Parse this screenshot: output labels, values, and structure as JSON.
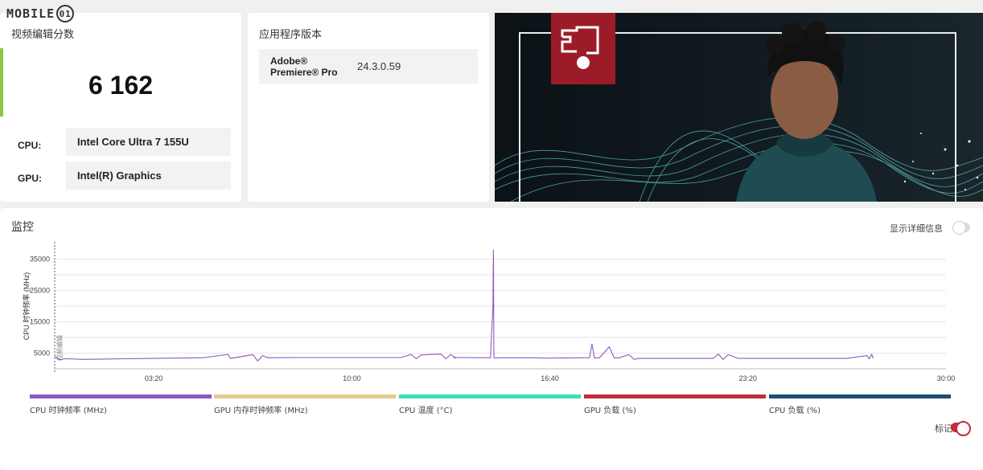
{
  "logo": {
    "text": "MOBILE",
    "badge": "01"
  },
  "score_card": {
    "title": "视频编辑分数",
    "score": "6 162",
    "cpu_label": "CPU:",
    "cpu_value": "Intel Core Ultra 7 155U",
    "gpu_label": "GPU:",
    "gpu_value": "Intel(R) Graphics",
    "accent_color": "#8dc63f"
  },
  "version_card": {
    "title": "应用程序版本",
    "app_name": "Adobe® Premiere® Pro",
    "app_version": "24.3.0.59"
  },
  "hero": {
    "icon": "video-editing-icon",
    "accent_color": "#9b1c28"
  },
  "monitor": {
    "title": "监控",
    "detail_toggle_label": "显示详细信息",
    "detail_toggle_on": false,
    "marker_toggle_label": "标记",
    "marker_toggle_on": true
  },
  "legend": [
    {
      "label": "CPU 时钟频率 (MHz)",
      "color": "#8e57c2"
    },
    {
      "label": "GPU 内存时钟频率 (MHz)",
      "color": "#e6c98b"
    },
    {
      "label": "CPU 温度 (°C)",
      "color": "#3fdbbd"
    },
    {
      "label": "GPU 负载 (%)",
      "color": "#c22d3a"
    },
    {
      "label": "CPU 负载 (%)",
      "color": "#1f4e79"
    }
  ],
  "chart_data": {
    "type": "line",
    "ylabel": "CPU 时钟频率 (MHz)",
    "marker_label": "视频编辑",
    "ylim": [
      0,
      40000
    ],
    "yticks": [
      5000,
      15000,
      25000,
      35000
    ],
    "ytick_labels": [
      "5000",
      "15000",
      "25000",
      "35000"
    ],
    "xlim": [
      0,
      1800
    ],
    "xticks": [
      200,
      600,
      1000,
      1400,
      1800
    ],
    "xtick_labels": [
      "03:20",
      "10:00",
      "16:40",
      "23:20",
      "30:00"
    ],
    "grid": true,
    "series": [
      {
        "name": "CPU 时钟频率 (MHz)",
        "color": "#8e57c2",
        "x": [
          0,
          10,
          20,
          60,
          150,
          200,
          300,
          350,
          355,
          400,
          410,
          420,
          430,
          500,
          700,
          720,
          730,
          740,
          780,
          790,
          800,
          810,
          805,
          880,
          885,
          886,
          887,
          889,
          900,
          970,
          980,
          1000,
          1080,
          1085,
          1090,
          1100,
          1120,
          1130,
          1140,
          1160,
          1170,
          1180,
          1300,
          1330,
          1340,
          1350,
          1360,
          1380,
          1400,
          1500,
          1600,
          1640,
          1645,
          1650,
          1653
        ],
        "y": [
          4000,
          2800,
          3200,
          3000,
          3200,
          3300,
          3500,
          4600,
          3300,
          4500,
          2500,
          4200,
          3500,
          3600,
          3600,
          4600,
          3200,
          4400,
          4700,
          3200,
          4600,
          3400,
          3600,
          3500,
          20000,
          38000,
          3500,
          3400,
          3500,
          3500,
          3400,
          3400,
          3500,
          8000,
          3400,
          3500,
          7000,
          3400,
          3500,
          4500,
          3000,
          3300,
          3300,
          3300,
          4700,
          3000,
          4500,
          3300,
          3300,
          3300,
          3300,
          4200,
          3200,
          4600,
          3300
        ]
      }
    ]
  }
}
